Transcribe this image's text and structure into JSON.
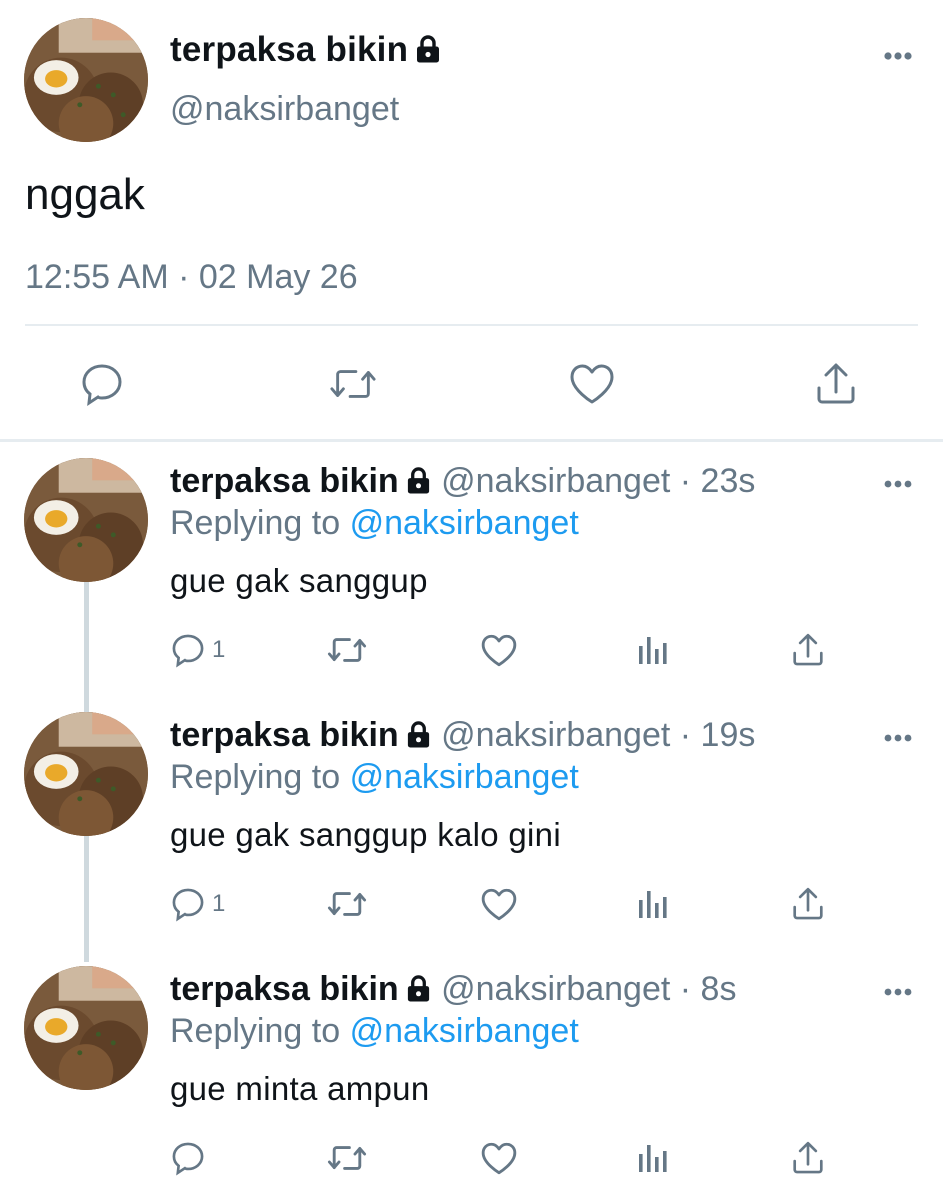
{
  "tweet": {
    "display_name": "terpaksa bikin",
    "handle": "@naksirbanget",
    "text": "nggak",
    "timestamp": "12:55 AM · 02 May 26",
    "colors": {
      "muted": "#657786",
      "link": "#1d9bf0",
      "text": "#0f1419"
    },
    "icons": [
      "lock-icon",
      "more-icon",
      "reply-icon",
      "retweet-icon",
      "like-icon",
      "share-icon"
    ]
  },
  "replies": [
    {
      "display_name": "terpaksa bikin",
      "handle": "@naksirbanget",
      "time": "· 23s",
      "replying_prefix": "Replying to",
      "replying_to": "@naksirbanget",
      "text": "gue gak sanggup",
      "reply_count": "1"
    },
    {
      "display_name": "terpaksa bikin",
      "handle": "@naksirbanget",
      "time": "· 19s",
      "replying_prefix": "Replying to",
      "replying_to": "@naksirbanget",
      "text": "gue gak sanggup kalo gini",
      "reply_count": "1"
    },
    {
      "display_name": "terpaksa bikin",
      "handle": "@naksirbanget",
      "time": "· 8s",
      "replying_prefix": "Replying to",
      "replying_to": "@naksirbanget",
      "text": "gue minta ampun",
      "reply_count": ""
    }
  ]
}
